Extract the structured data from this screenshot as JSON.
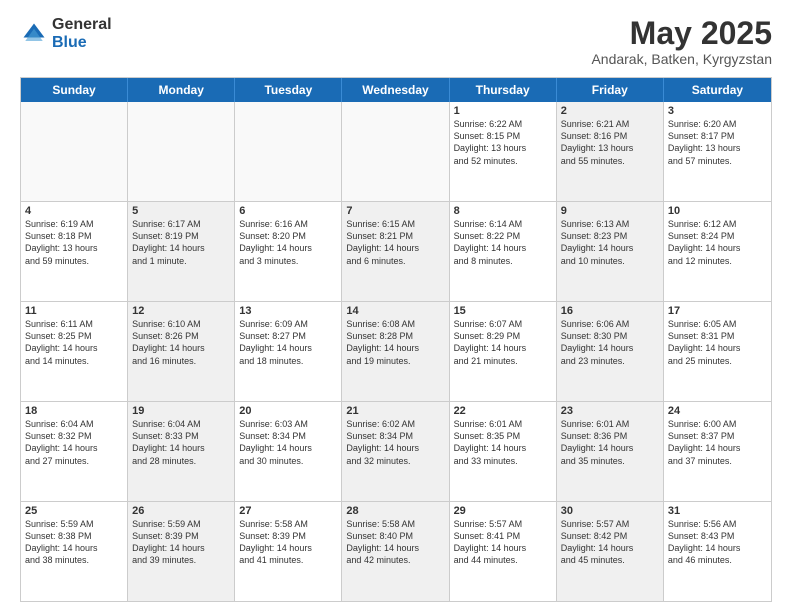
{
  "header": {
    "logo_general": "General",
    "logo_blue": "Blue",
    "month_year": "May 2025",
    "location": "Andarak, Batken, Kyrgyzstan"
  },
  "days_of_week": [
    "Sunday",
    "Monday",
    "Tuesday",
    "Wednesday",
    "Thursday",
    "Friday",
    "Saturday"
  ],
  "rows": [
    [
      {
        "day": "",
        "lines": [],
        "shaded": false
      },
      {
        "day": "",
        "lines": [],
        "shaded": false
      },
      {
        "day": "",
        "lines": [],
        "shaded": false
      },
      {
        "day": "",
        "lines": [],
        "shaded": false
      },
      {
        "day": "1",
        "lines": [
          "Sunrise: 6:22 AM",
          "Sunset: 8:15 PM",
          "Daylight: 13 hours",
          "and 52 minutes."
        ],
        "shaded": false
      },
      {
        "day": "2",
        "lines": [
          "Sunrise: 6:21 AM",
          "Sunset: 8:16 PM",
          "Daylight: 13 hours",
          "and 55 minutes."
        ],
        "shaded": true
      },
      {
        "day": "3",
        "lines": [
          "Sunrise: 6:20 AM",
          "Sunset: 8:17 PM",
          "Daylight: 13 hours",
          "and 57 minutes."
        ],
        "shaded": false
      }
    ],
    [
      {
        "day": "4",
        "lines": [
          "Sunrise: 6:19 AM",
          "Sunset: 8:18 PM",
          "Daylight: 13 hours",
          "and 59 minutes."
        ],
        "shaded": false
      },
      {
        "day": "5",
        "lines": [
          "Sunrise: 6:17 AM",
          "Sunset: 8:19 PM",
          "Daylight: 14 hours",
          "and 1 minute."
        ],
        "shaded": true
      },
      {
        "day": "6",
        "lines": [
          "Sunrise: 6:16 AM",
          "Sunset: 8:20 PM",
          "Daylight: 14 hours",
          "and 3 minutes."
        ],
        "shaded": false
      },
      {
        "day": "7",
        "lines": [
          "Sunrise: 6:15 AM",
          "Sunset: 8:21 PM",
          "Daylight: 14 hours",
          "and 6 minutes."
        ],
        "shaded": true
      },
      {
        "day": "8",
        "lines": [
          "Sunrise: 6:14 AM",
          "Sunset: 8:22 PM",
          "Daylight: 14 hours",
          "and 8 minutes."
        ],
        "shaded": false
      },
      {
        "day": "9",
        "lines": [
          "Sunrise: 6:13 AM",
          "Sunset: 8:23 PM",
          "Daylight: 14 hours",
          "and 10 minutes."
        ],
        "shaded": true
      },
      {
        "day": "10",
        "lines": [
          "Sunrise: 6:12 AM",
          "Sunset: 8:24 PM",
          "Daylight: 14 hours",
          "and 12 minutes."
        ],
        "shaded": false
      }
    ],
    [
      {
        "day": "11",
        "lines": [
          "Sunrise: 6:11 AM",
          "Sunset: 8:25 PM",
          "Daylight: 14 hours",
          "and 14 minutes."
        ],
        "shaded": false
      },
      {
        "day": "12",
        "lines": [
          "Sunrise: 6:10 AM",
          "Sunset: 8:26 PM",
          "Daylight: 14 hours",
          "and 16 minutes."
        ],
        "shaded": true
      },
      {
        "day": "13",
        "lines": [
          "Sunrise: 6:09 AM",
          "Sunset: 8:27 PM",
          "Daylight: 14 hours",
          "and 18 minutes."
        ],
        "shaded": false
      },
      {
        "day": "14",
        "lines": [
          "Sunrise: 6:08 AM",
          "Sunset: 8:28 PM",
          "Daylight: 14 hours",
          "and 19 minutes."
        ],
        "shaded": true
      },
      {
        "day": "15",
        "lines": [
          "Sunrise: 6:07 AM",
          "Sunset: 8:29 PM",
          "Daylight: 14 hours",
          "and 21 minutes."
        ],
        "shaded": false
      },
      {
        "day": "16",
        "lines": [
          "Sunrise: 6:06 AM",
          "Sunset: 8:30 PM",
          "Daylight: 14 hours",
          "and 23 minutes."
        ],
        "shaded": true
      },
      {
        "day": "17",
        "lines": [
          "Sunrise: 6:05 AM",
          "Sunset: 8:31 PM",
          "Daylight: 14 hours",
          "and 25 minutes."
        ],
        "shaded": false
      }
    ],
    [
      {
        "day": "18",
        "lines": [
          "Sunrise: 6:04 AM",
          "Sunset: 8:32 PM",
          "Daylight: 14 hours",
          "and 27 minutes."
        ],
        "shaded": false
      },
      {
        "day": "19",
        "lines": [
          "Sunrise: 6:04 AM",
          "Sunset: 8:33 PM",
          "Daylight: 14 hours",
          "and 28 minutes."
        ],
        "shaded": true
      },
      {
        "day": "20",
        "lines": [
          "Sunrise: 6:03 AM",
          "Sunset: 8:34 PM",
          "Daylight: 14 hours",
          "and 30 minutes."
        ],
        "shaded": false
      },
      {
        "day": "21",
        "lines": [
          "Sunrise: 6:02 AM",
          "Sunset: 8:34 PM",
          "Daylight: 14 hours",
          "and 32 minutes."
        ],
        "shaded": true
      },
      {
        "day": "22",
        "lines": [
          "Sunrise: 6:01 AM",
          "Sunset: 8:35 PM",
          "Daylight: 14 hours",
          "and 33 minutes."
        ],
        "shaded": false
      },
      {
        "day": "23",
        "lines": [
          "Sunrise: 6:01 AM",
          "Sunset: 8:36 PM",
          "Daylight: 14 hours",
          "and 35 minutes."
        ],
        "shaded": true
      },
      {
        "day": "24",
        "lines": [
          "Sunrise: 6:00 AM",
          "Sunset: 8:37 PM",
          "Daylight: 14 hours",
          "and 37 minutes."
        ],
        "shaded": false
      }
    ],
    [
      {
        "day": "25",
        "lines": [
          "Sunrise: 5:59 AM",
          "Sunset: 8:38 PM",
          "Daylight: 14 hours",
          "and 38 minutes."
        ],
        "shaded": false
      },
      {
        "day": "26",
        "lines": [
          "Sunrise: 5:59 AM",
          "Sunset: 8:39 PM",
          "Daylight: 14 hours",
          "and 39 minutes."
        ],
        "shaded": true
      },
      {
        "day": "27",
        "lines": [
          "Sunrise: 5:58 AM",
          "Sunset: 8:39 PM",
          "Daylight: 14 hours",
          "and 41 minutes."
        ],
        "shaded": false
      },
      {
        "day": "28",
        "lines": [
          "Sunrise: 5:58 AM",
          "Sunset: 8:40 PM",
          "Daylight: 14 hours",
          "and 42 minutes."
        ],
        "shaded": true
      },
      {
        "day": "29",
        "lines": [
          "Sunrise: 5:57 AM",
          "Sunset: 8:41 PM",
          "Daylight: 14 hours",
          "and 44 minutes."
        ],
        "shaded": false
      },
      {
        "day": "30",
        "lines": [
          "Sunrise: 5:57 AM",
          "Sunset: 8:42 PM",
          "Daylight: 14 hours",
          "and 45 minutes."
        ],
        "shaded": true
      },
      {
        "day": "31",
        "lines": [
          "Sunrise: 5:56 AM",
          "Sunset: 8:43 PM",
          "Daylight: 14 hours",
          "and 46 minutes."
        ],
        "shaded": false
      }
    ]
  ]
}
